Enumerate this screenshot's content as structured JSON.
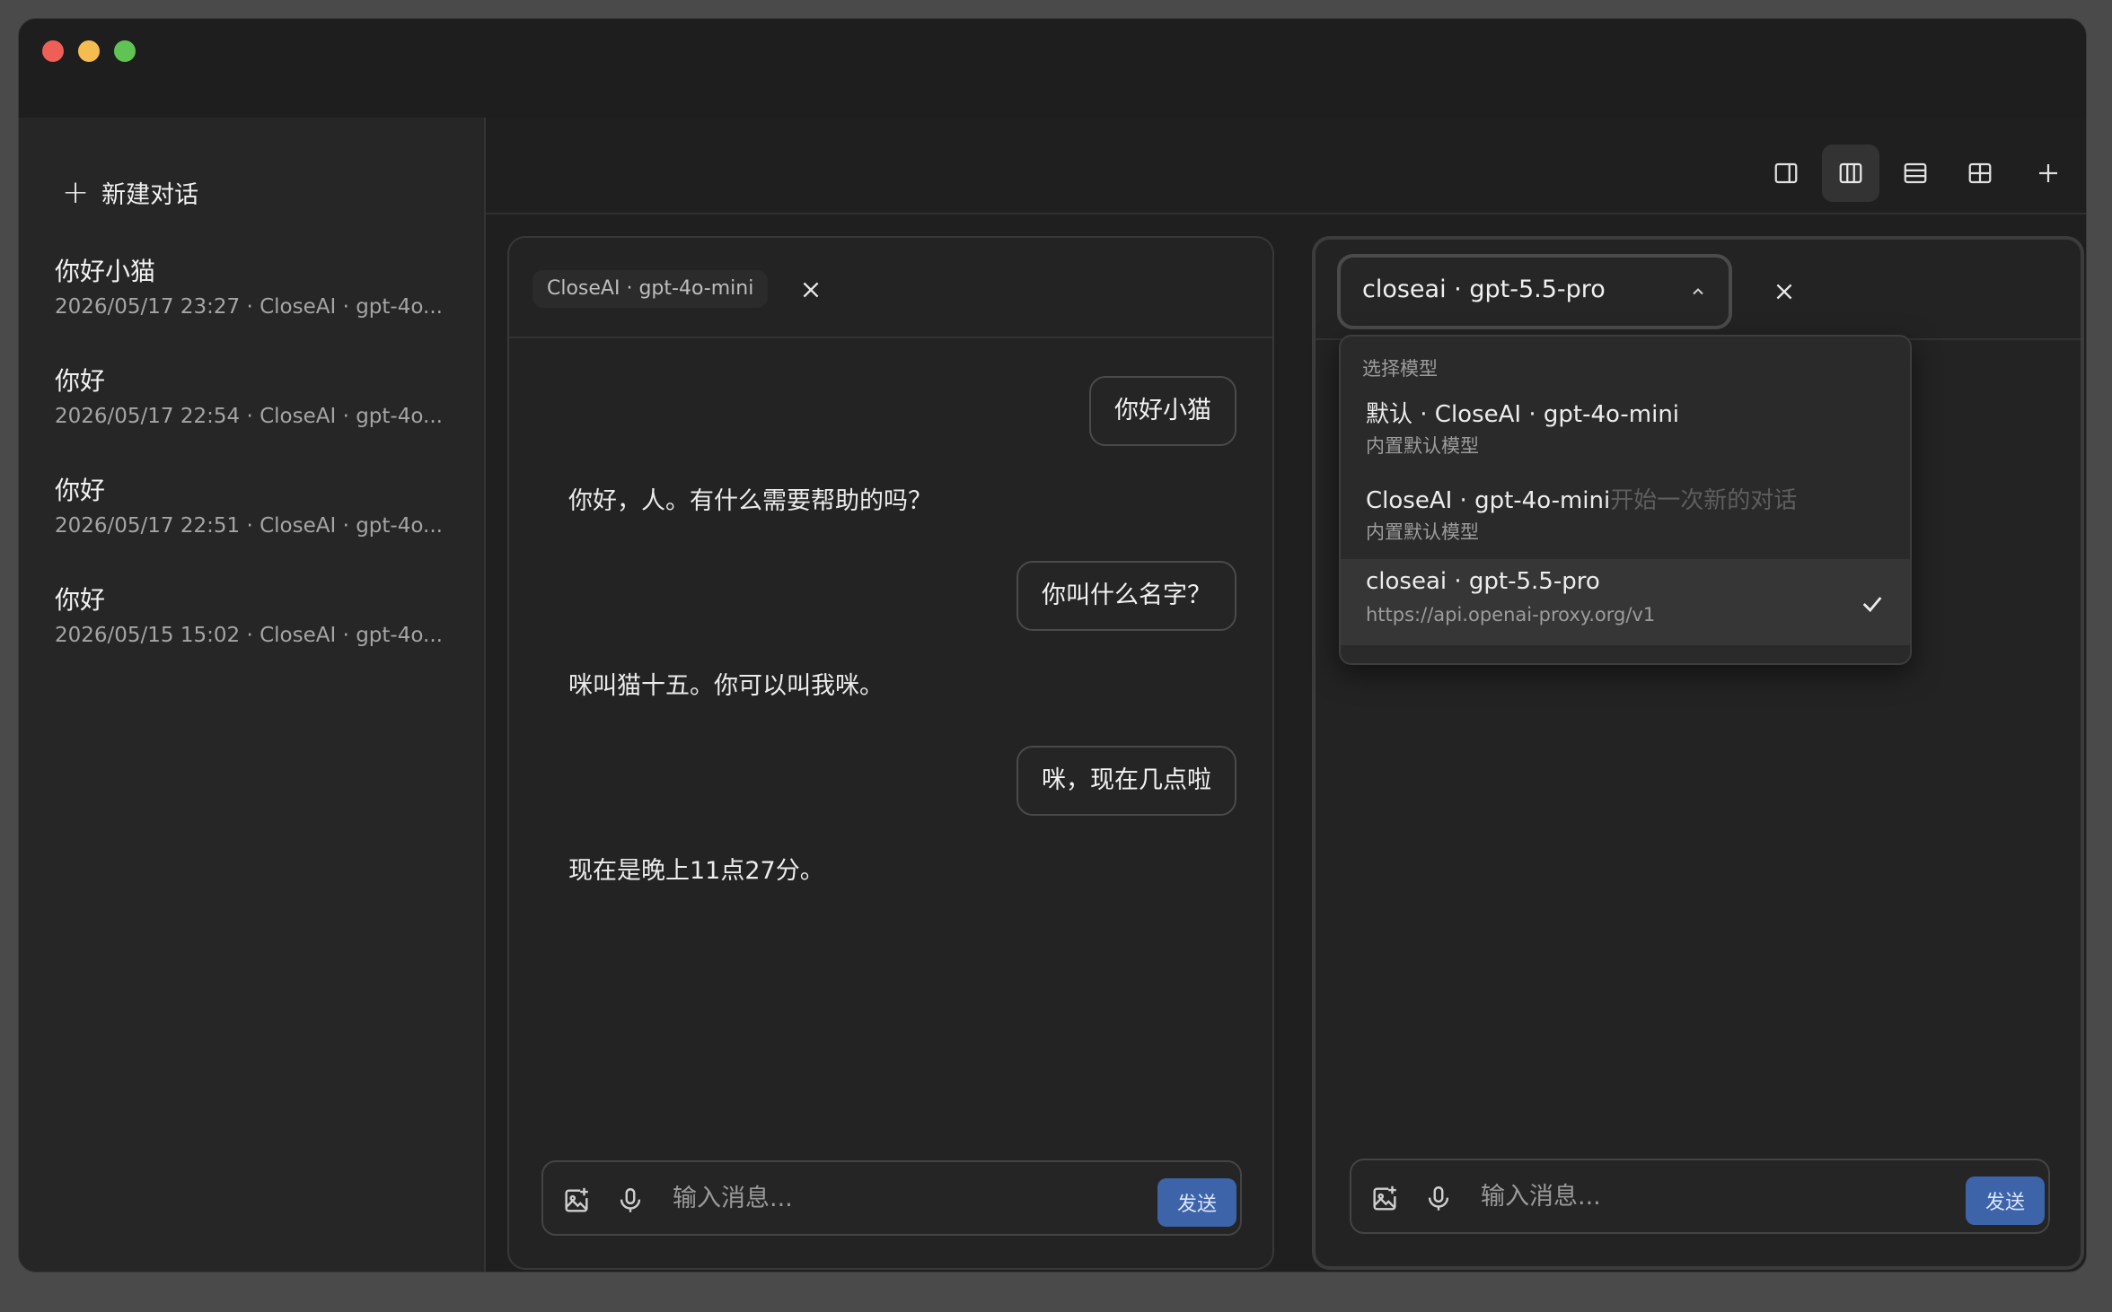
{
  "sidebar": {
    "new_chat_label": "新建对话",
    "conversations": [
      {
        "title": "你好小猫",
        "meta": "2026/05/17 23:27  · CloseAI · gpt-4o..."
      },
      {
        "title": "你好",
        "meta": "2026/05/17 22:54  · CloseAI · gpt-4o..."
      },
      {
        "title": "你好",
        "meta": "2026/05/17 22:51  · CloseAI · gpt-4o..."
      },
      {
        "title": "你好",
        "meta": "2026/05/15 15:02  · CloseAI · gpt-4o..."
      }
    ]
  },
  "toolbar": {
    "icons": [
      "single-panel-icon",
      "two-column-icon",
      "rows-icon",
      "grid-icon",
      "add-icon"
    ],
    "active": "two-column-icon"
  },
  "left_panel": {
    "model_label": "CloseAI · gpt-4o-mini",
    "messages": [
      {
        "role": "user",
        "text": "你好小猫"
      },
      {
        "role": "assistant",
        "text": "你好，人。有什么需要帮助的吗？"
      },
      {
        "role": "user",
        "text": "你叫什么名字？"
      },
      {
        "role": "assistant",
        "text": "咪叫猫十五。你可以叫我咪。"
      },
      {
        "role": "user",
        "text": "咪，现在几点啦"
      },
      {
        "role": "assistant",
        "text": "现在是晚上11点27分。"
      }
    ],
    "input_placeholder": "输入消息...",
    "send_label": "发送"
  },
  "right_panel": {
    "selected_model": "closeai · gpt-5.5-pro",
    "dropdown": {
      "header": "选择模型",
      "items": [
        {
          "title": "默认 · CloseAI · gpt-4o-mini",
          "hint": "",
          "subtitle": "内置默认模型",
          "selected": false
        },
        {
          "title": "CloseAI · gpt-4o-mini",
          "hint": "开始一次新的对话",
          "subtitle": "内置默认模型",
          "selected": false
        },
        {
          "title": "closeai · gpt-5.5-pro",
          "hint": "",
          "subtitle": "https://api.openai-proxy.org/v1",
          "selected": true
        }
      ]
    },
    "input_placeholder": "输入消息...",
    "send_label": "发送"
  },
  "colors": {
    "background": "#1f1f1f",
    "sidebar": "#262626",
    "send_button": "#3d63a8",
    "traffic_red": "#ed5f57",
    "traffic_yellow": "#f5bd4f",
    "traffic_green": "#60c454"
  }
}
